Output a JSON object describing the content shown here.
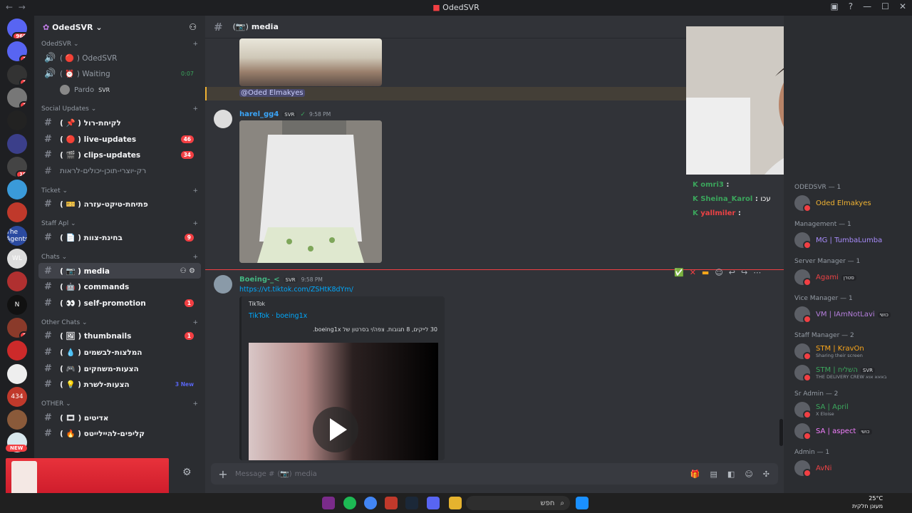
{
  "title_bar": {
    "title": "OdedSVR",
    "nav_back": "←",
    "nav_fwd": "→"
  },
  "server_rail": [
    {
      "name": "dm",
      "badge": "965"
    },
    {
      "name": "discord-home",
      "badge": "1"
    },
    {
      "name": "server-2",
      "badge": "1"
    },
    {
      "name": "server-3",
      "badge": "1"
    },
    {
      "name": "server-4",
      "badge": ""
    },
    {
      "name": "server-5",
      "badge": ""
    },
    {
      "name": "server-6",
      "badge": "19"
    },
    {
      "name": "server-7",
      "badge": ""
    },
    {
      "name": "server-8",
      "badge": ""
    },
    {
      "name": "The Agents",
      "badge": ""
    },
    {
      "name": "WL",
      "badge": ""
    },
    {
      "name": "server-11",
      "badge": ""
    },
    {
      "name": "N",
      "badge": ""
    },
    {
      "name": "server-13",
      "badge": "3"
    },
    {
      "name": "server-14",
      "badge": ""
    },
    {
      "name": "server-15",
      "badge": ""
    },
    {
      "name": "434",
      "badge": ""
    },
    {
      "name": "server-17",
      "badge": ""
    },
    {
      "name": "server-18",
      "badge": ""
    }
  ],
  "sidebar": {
    "server_name": "OdedSVR",
    "voice_category": "OdedSVR",
    "voice_channels": [
      {
        "label": "OdedSVR",
        "emoji": "🔴"
      },
      {
        "label": "Waiting",
        "emoji": "⏰",
        "timer": "0:07"
      }
    ],
    "voice_user": {
      "name": "Pardo",
      "tag": "SVR"
    },
    "categories": [
      {
        "name": "Social Updates",
        "channels": [
          {
            "label": "לקיחת-רול",
            "emoji": "📌",
            "state": "unread"
          },
          {
            "label": "live-updates",
            "emoji": "🔴",
            "state": "unread",
            "badge": "46"
          },
          {
            "label": "clips-updates",
            "emoji": "🎬",
            "state": "unread",
            "badge": "34"
          },
          {
            "label": "רק-יוצרי-תוכן-יכולים-לראות",
            "emoji": "",
            "state": "muted"
          }
        ]
      },
      {
        "name": "Ticket",
        "channels": [
          {
            "label": "פתיחת-טיקט-עזרה",
            "emoji": "🎫",
            "state": "unread"
          }
        ]
      },
      {
        "name": "Staff Apl",
        "channels": [
          {
            "label": "בחינת-צוות",
            "emoji": "📄",
            "state": "unread",
            "badge": "9"
          }
        ]
      },
      {
        "name": "Chats",
        "channels": [
          {
            "label": "media",
            "emoji": "📷",
            "state": "active"
          },
          {
            "label": "commands",
            "emoji": "🤖",
            "state": "unread"
          },
          {
            "label": "self-promotion",
            "emoji": "👀",
            "state": "unread",
            "badge": "1"
          }
        ]
      },
      {
        "name": "Other Chats",
        "channels": [
          {
            "label": "thumbnails",
            "emoji": "🖼",
            "state": "unread",
            "badge": "1"
          },
          {
            "label": "המלצות-לבשמים",
            "emoji": "💧",
            "state": "unread"
          },
          {
            "label": "הצעות-משחקים",
            "emoji": "🎮",
            "state": "unread"
          },
          {
            "label": "הצעות-לשרת",
            "emoji": "💡",
            "state": "unread",
            "new": "3 New"
          }
        ]
      },
      {
        "name": "OTHER",
        "channels": [
          {
            "label": "אדיטים",
            "emoji": "🎞",
            "state": "unread"
          },
          {
            "label": "קליפים-להיילייטס",
            "emoji": "🔥",
            "state": "unread"
          }
        ]
      }
    ],
    "new_badge": "NEW"
  },
  "chat": {
    "channel": "media",
    "channel_emoji": "📷",
    "mention_line": "@Oded Elmakyes",
    "messages": [
      {
        "user": "harel_gg4",
        "tag": "SVR",
        "time": "9:58 PM",
        "color": "#3ba5f8"
      },
      {
        "user": "Boeing-_<",
        "tag": "SVR",
        "time": "9:58 PM",
        "color": "#43b581",
        "link": "https://vt.tiktok.com/ZSHtK8dYm/",
        "embed": {
          "provider": "TikTok",
          "title": "TikTok · boeing1x",
          "desc": "30 לייקים, 8 תגובות. צפה/י בסרטון של boeing1x."
        }
      }
    ],
    "composer_placeholder": "Message #",
    "composer_channel": "media"
  },
  "stream_chat": [
    {
      "user": "omri3",
      "color": "#3ba55c"
    },
    {
      "user": "Sheina_Karol",
      "color": "#3ba55c",
      "text": "עכו"
    },
    {
      "user": "yallmiler",
      "color": "#ed4245"
    }
  ],
  "members": {
    "groups": [
      {
        "name": "ODEDSVR — 1",
        "members": [
          {
            "name": "Oded Elmakyes",
            "color": "#f0b232"
          }
        ]
      },
      {
        "name": "Management — 1",
        "members": [
          {
            "name": "MG | TumbaLumba",
            "color": "#a78bfa"
          }
        ]
      },
      {
        "name": "Server Manager — 1",
        "members": [
          {
            "name": "Agami",
            "color": "#ed4245",
            "extra": "סטרן"
          }
        ]
      },
      {
        "name": "Vice Manager — 1",
        "members": [
          {
            "name": "VM | IAmNotLavi",
            "color": "#b57edc",
            "extra": "כושי"
          }
        ]
      },
      {
        "name": "Staff Manager — 2",
        "members": [
          {
            "name": "STM | KravOn",
            "color": "#faa61a",
            "sub": "Sharing their screen"
          },
          {
            "name": "STM | השליח",
            "color": "#3ba55c",
            "sub": "THE DELIVERY CREW באאא אוא",
            "extra": "SVR"
          }
        ]
      },
      {
        "name": "Sr Admin — 2",
        "members": [
          {
            "name": "SA | April",
            "color": "#3ba55c",
            "sub": "X Eloise"
          },
          {
            "name": "SA | aspect",
            "color": "#f47fff",
            "extra": "כושי"
          }
        ]
      },
      {
        "name": "Admin — 1",
        "members": [
          {
            "name": "AvNi",
            "color": "#ed4245"
          }
        ]
      }
    ]
  },
  "taskbar": {
    "search_label": "חפש",
    "weather_temp": "25°C",
    "weather_desc": "מעונן חלקית"
  },
  "colors": {
    "accent": "#5865f2",
    "danger": "#f23f43",
    "bg_main": "#313338",
    "bg_side": "#2b2d31"
  }
}
